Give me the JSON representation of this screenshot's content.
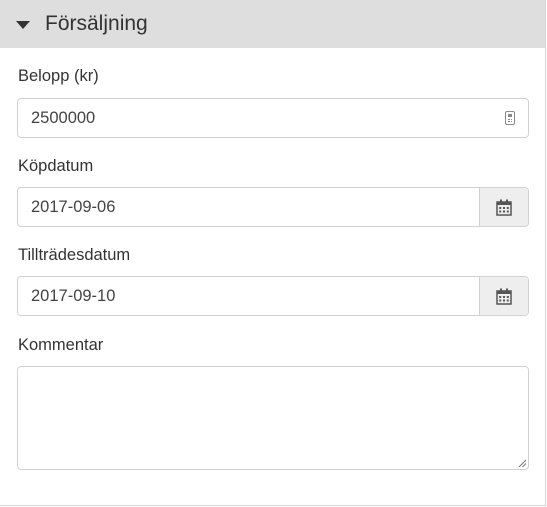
{
  "section": {
    "title": "Försäljning"
  },
  "fields": {
    "amount": {
      "label": "Belopp (kr)",
      "value": "2500000"
    },
    "purchase_date": {
      "label": "Köpdatum",
      "value": "2017-09-06"
    },
    "access_date": {
      "label": "Tillträdesdatum",
      "value": "2017-09-10"
    },
    "comment": {
      "label": "Kommentar",
      "value": ""
    }
  },
  "icons": {
    "collapse": "caret-down-icon",
    "amount": "calculator-icon",
    "date": "calendar-icon"
  }
}
